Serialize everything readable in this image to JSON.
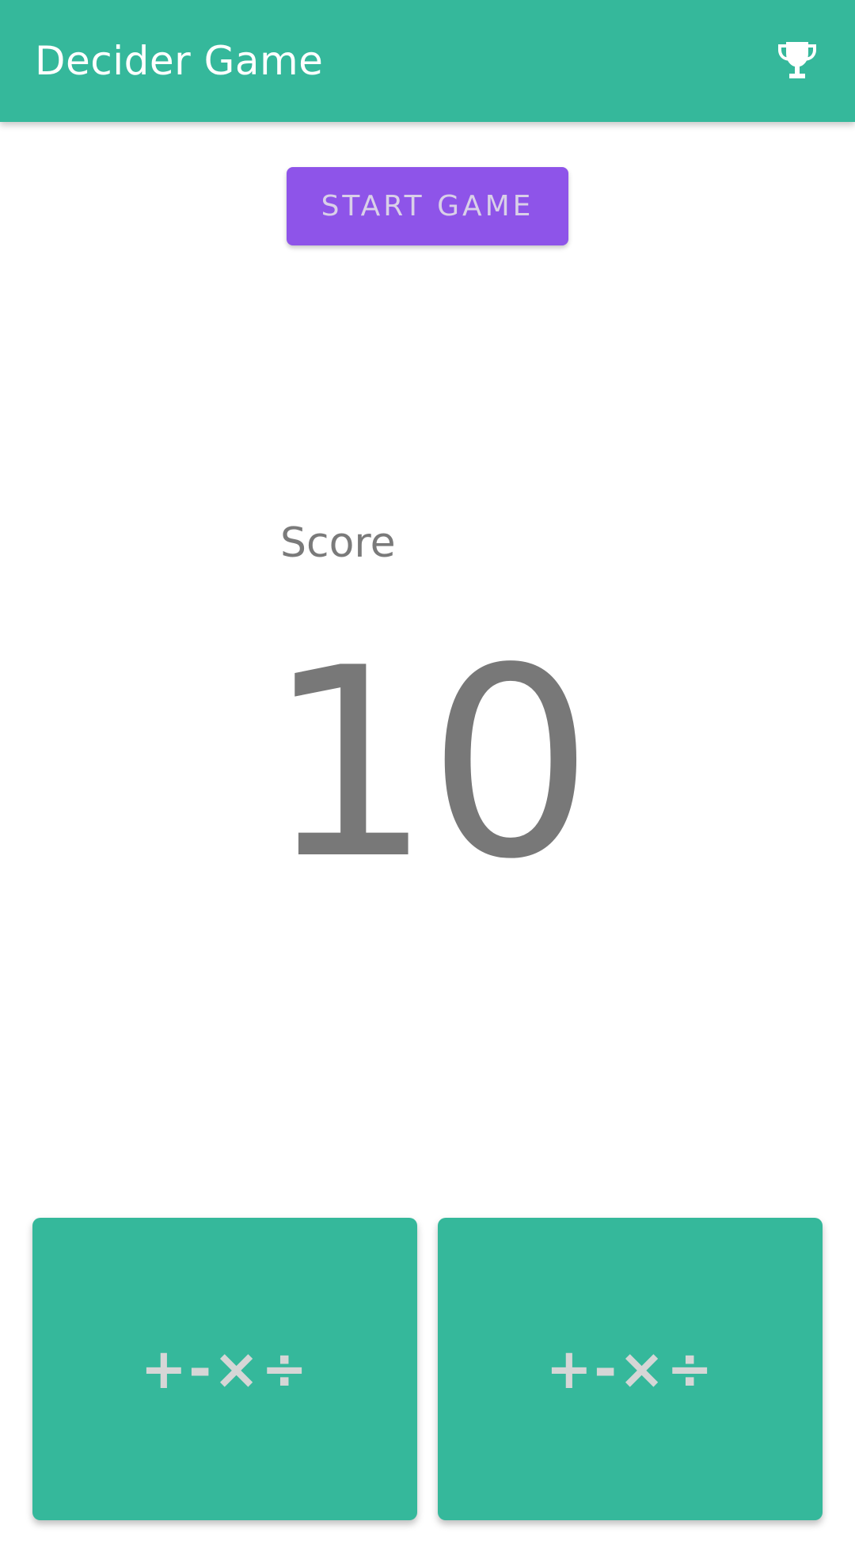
{
  "app_bar": {
    "title": "Decider Game",
    "action_icon": "trophy-icon",
    "background": "#35b89b"
  },
  "start_button": {
    "label": "START GAME",
    "background": "#8e54e9"
  },
  "score": {
    "label": "Score",
    "value": "10"
  },
  "choices": [
    {
      "label": "+-×÷"
    },
    {
      "label": "+-×÷"
    }
  ]
}
